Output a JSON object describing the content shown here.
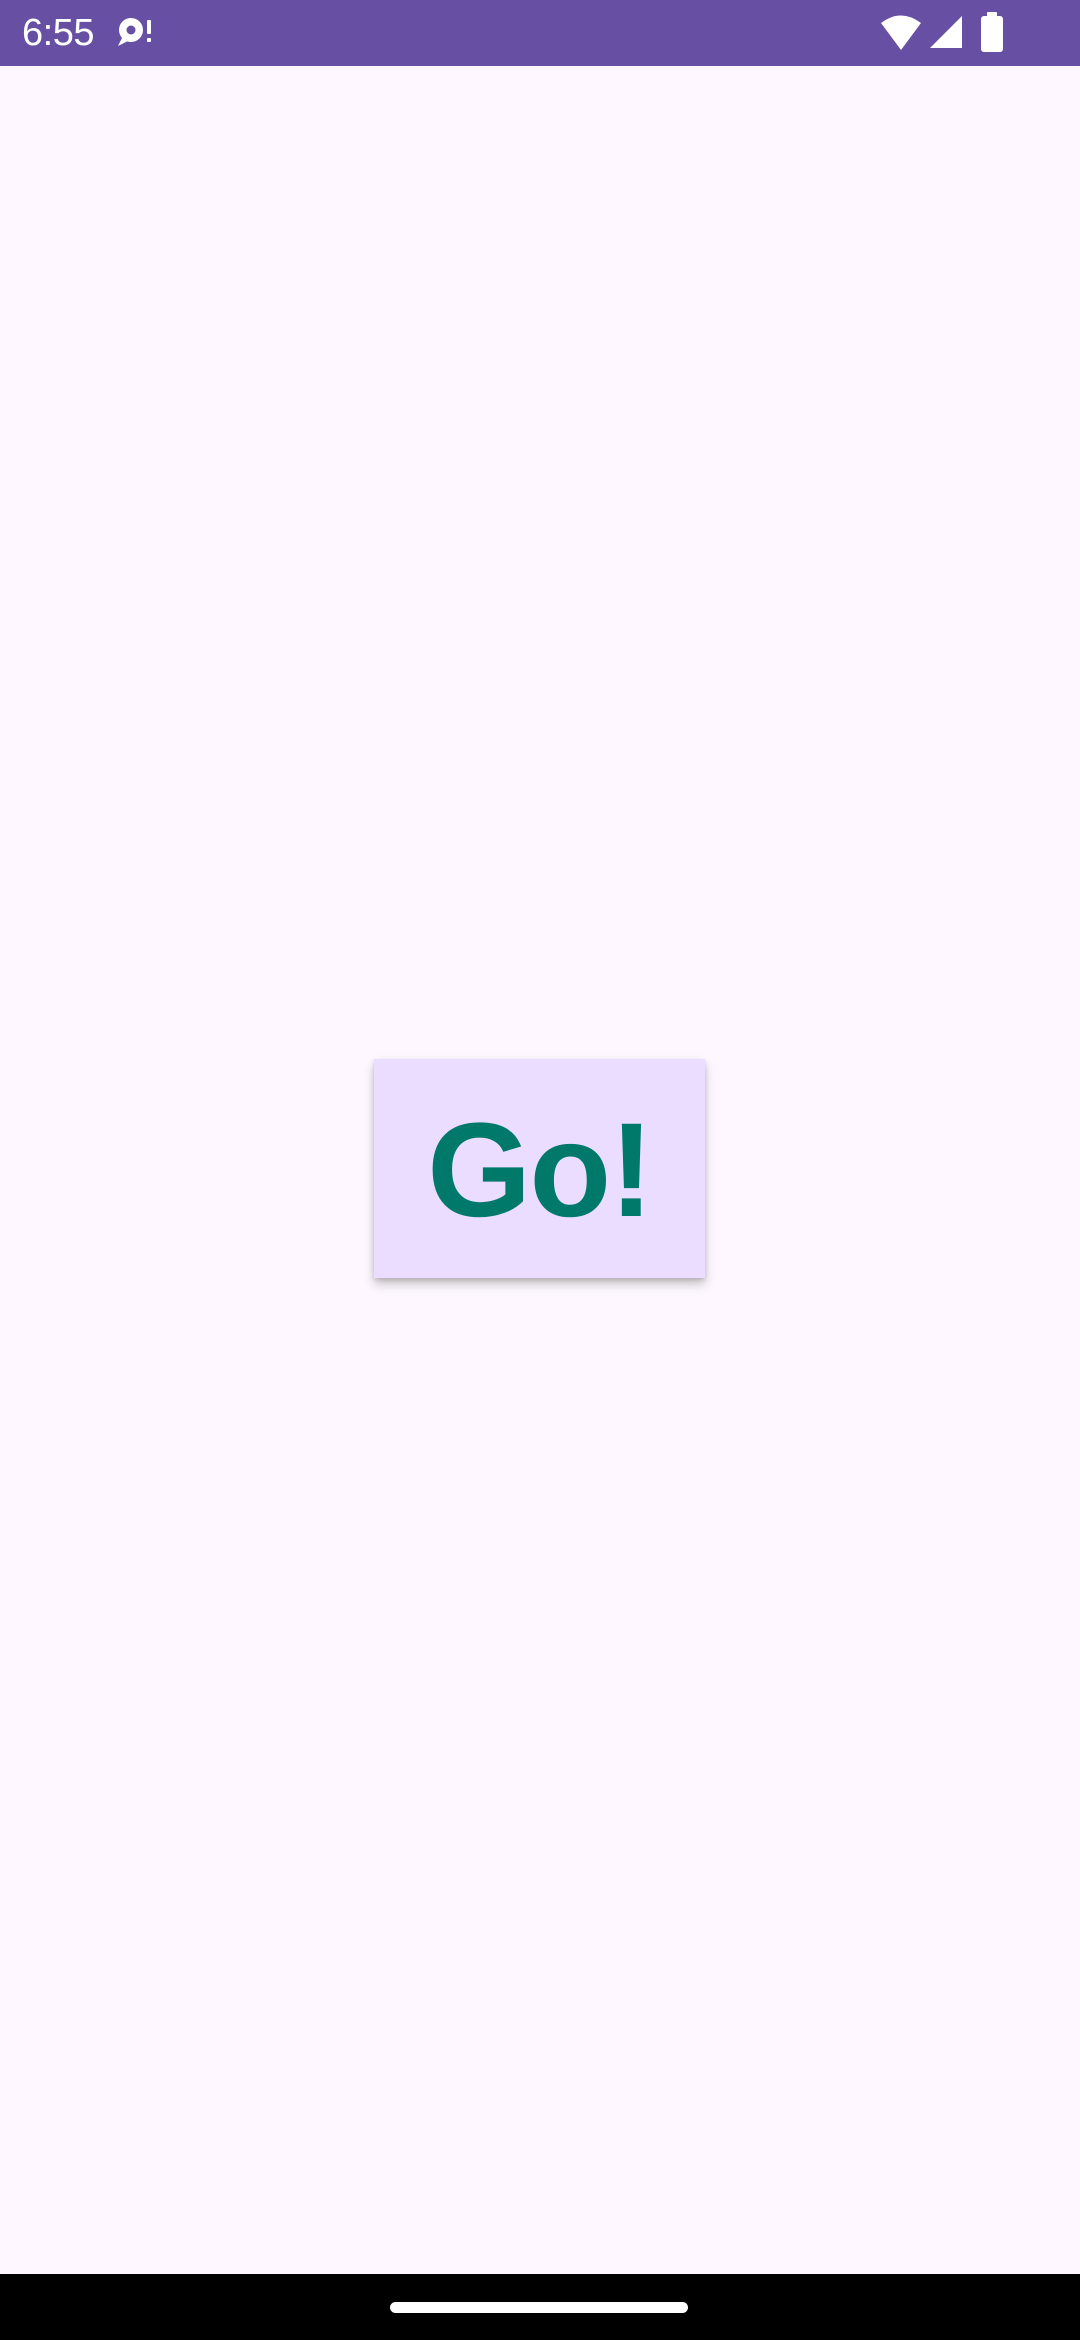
{
  "status_bar": {
    "time": "6:55",
    "icons": [
      "notification-icon",
      "wifi-icon",
      "signal-icon",
      "battery-icon"
    ],
    "background_color": "#6750A4"
  },
  "main": {
    "go_button": {
      "label": "Go!",
      "background_color": "#EADDFF",
      "text_color": "#00796B"
    },
    "background_color": "#FEF7FF"
  },
  "nav_bar": {
    "background_color": "#000000"
  }
}
